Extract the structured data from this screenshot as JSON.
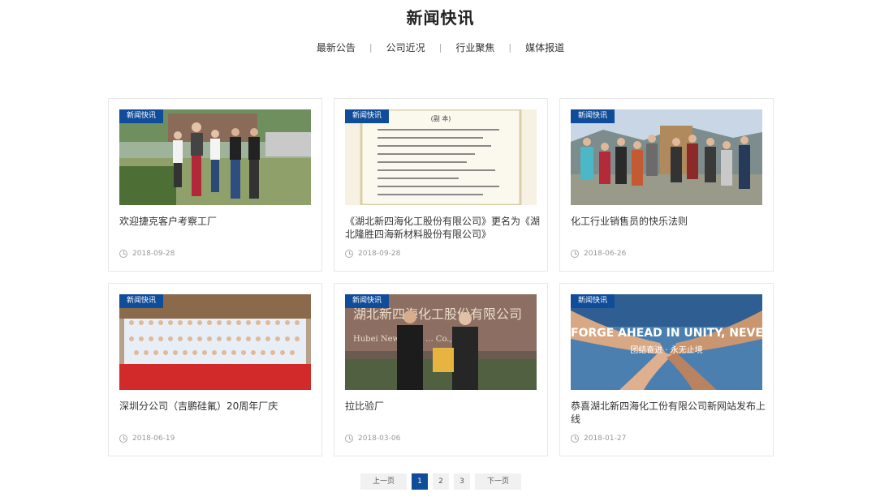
{
  "page": {
    "title": "新闻快讯"
  },
  "subnav": {
    "items": [
      "最新公告",
      "公司近况",
      "行业聚焦",
      "媒体报道"
    ],
    "separator": "|"
  },
  "badge_label": "新闻快讯",
  "cards": [
    {
      "title": "欢迎捷克客户考察工厂",
      "date": "2018-09-28"
    },
    {
      "title": "《湖北新四海化工股份有限公司》更名为《湖北隆胜四海新材料股份有限公司》",
      "date": "2018-09-28"
    },
    {
      "title": "化工行业销售员的快乐法则",
      "date": "2018-06-26"
    },
    {
      "title": "深圳分公司（吉鹏硅氟）20周年厂庆",
      "date": "2018-06-19"
    },
    {
      "title": "拉比验厂",
      "date": "2018-03-06"
    },
    {
      "title": "恭喜湖北新四海化工份有限公司新网站发布上线",
      "date": "2018-01-27"
    }
  ],
  "images": {
    "card2_doc_title": "(副 本)",
    "card5_sign_text": "湖北新四海化工股份有限公司",
    "card5_sign_en": "Hubei New Sihai ... Co.,Ltd.",
    "card6_banner_en": "FORGE AHEAD IN UNITY, NEVER-ENDING",
    "card6_banner_cn": "团结奋进 · 永无止境"
  },
  "pagination": {
    "prev": "上一页",
    "pages": [
      "1",
      "2",
      "3"
    ],
    "current": "1",
    "next": "下一页"
  },
  "colors": {
    "accent": "#0f4c99",
    "text": "#333333",
    "muted": "#999999"
  }
}
